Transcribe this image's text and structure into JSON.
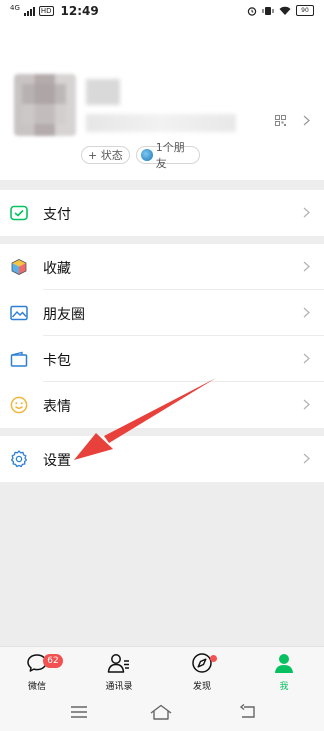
{
  "status_bar": {
    "network": "4G",
    "hd": "HD",
    "time": "12:49",
    "battery": "90"
  },
  "profile": {
    "status_label": "+ 状态",
    "friends_label": "1个朋友"
  },
  "menu": {
    "pay": "支付",
    "favorites": "收藏",
    "moments": "朋友圈",
    "cards": "卡包",
    "stickers": "表情",
    "settings": "设置"
  },
  "tabs": {
    "chats": "微信",
    "chats_badge": "62",
    "contacts": "通讯录",
    "discover": "发现",
    "me": "我"
  },
  "colors": {
    "accent_green": "#07c160",
    "badge_red": "#f35252",
    "annotation_red": "#e8403a"
  },
  "icons": {
    "pay": "pay-icon",
    "favorites": "cube-icon",
    "moments": "picture-icon",
    "cards": "card-icon",
    "stickers": "smile-icon",
    "settings": "gear-icon"
  }
}
